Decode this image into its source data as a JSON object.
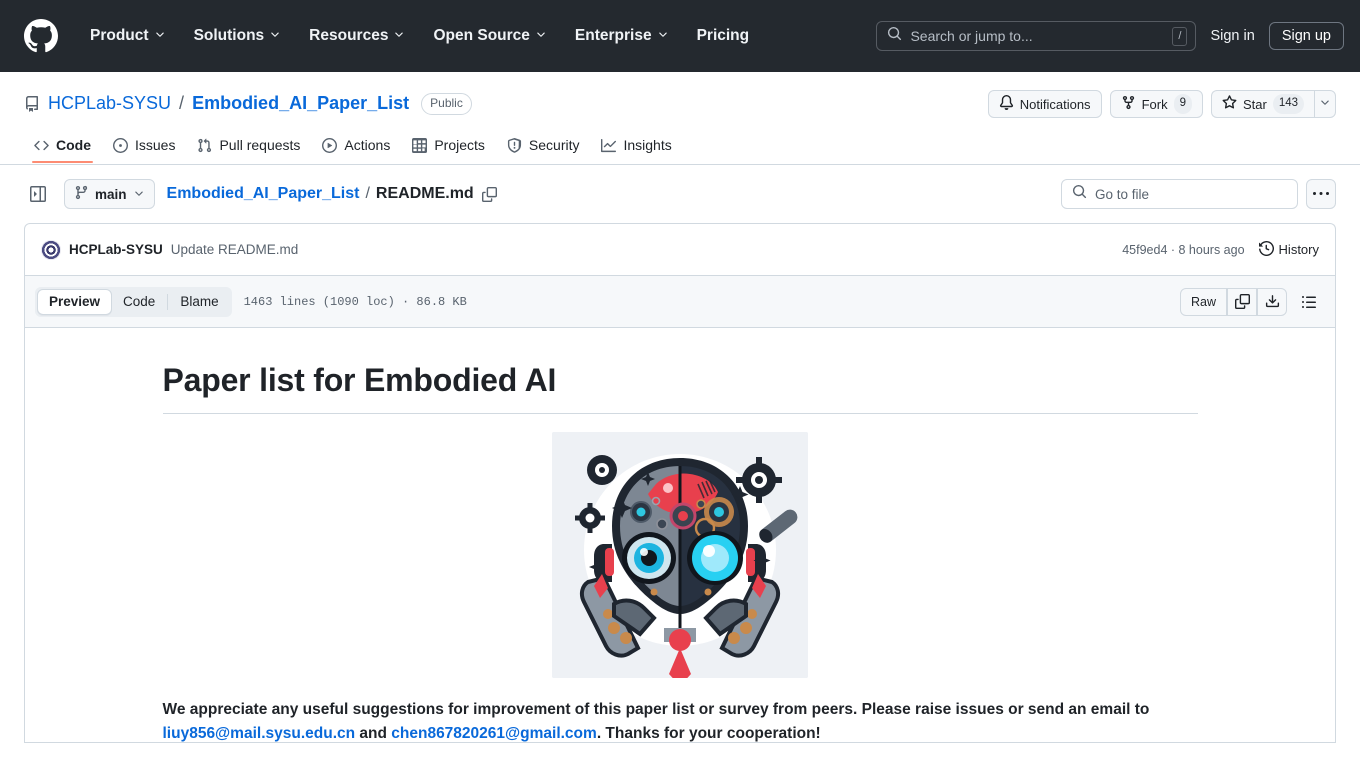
{
  "header": {
    "logo_icon": "github-mark-icon",
    "nav": [
      {
        "label": "Product",
        "has_caret": true
      },
      {
        "label": "Solutions",
        "has_caret": true
      },
      {
        "label": "Resources",
        "has_caret": true
      },
      {
        "label": "Open Source",
        "has_caret": true
      },
      {
        "label": "Enterprise",
        "has_caret": true
      },
      {
        "label": "Pricing",
        "has_caret": false
      }
    ],
    "search": {
      "placeholder": "Search or jump to...",
      "shortcut_key": "/",
      "icon": "search-icon"
    },
    "sign_in": "Sign in",
    "sign_up": "Sign up"
  },
  "repo": {
    "icon": "repo-book-icon",
    "owner": "HCPLab-SYSU",
    "separator": "/",
    "name": "Embodied_AI_Paper_List",
    "visibility": "Public",
    "actions": {
      "notifications": {
        "label": "Notifications",
        "icon": "bell-icon"
      },
      "fork": {
        "label": "Fork",
        "count": "9",
        "icon": "fork-icon"
      },
      "star": {
        "label": "Star",
        "count": "143",
        "icon": "star-icon",
        "caret_icon": "chevron-down-icon"
      }
    },
    "tabs": [
      {
        "label": "Code",
        "icon": "code-icon",
        "active": true
      },
      {
        "label": "Issues",
        "icon": "issue-opened-icon",
        "active": false
      },
      {
        "label": "Pull requests",
        "icon": "git-pull-request-icon",
        "active": false
      },
      {
        "label": "Actions",
        "icon": "play-icon",
        "active": false
      },
      {
        "label": "Projects",
        "icon": "table-icon",
        "active": false
      },
      {
        "label": "Security",
        "icon": "shield-icon",
        "active": false
      },
      {
        "label": "Insights",
        "icon": "graph-icon",
        "active": false
      }
    ]
  },
  "file_nav": {
    "sidebar_toggle_icon": "sidebar-expand-icon",
    "branch": {
      "label": "main",
      "icon": "git-branch-icon",
      "caret_icon": "chevron-down-icon"
    },
    "breadcrumb": {
      "repo": "Embodied_AI_Paper_List",
      "separator": "/",
      "file": "README.md",
      "copy_icon": "copy-path-icon"
    },
    "go_to_file": {
      "placeholder": "Go to file",
      "icon": "search-icon"
    },
    "more_menu": {
      "label": "...",
      "icon": "kebab-horizontal-icon"
    }
  },
  "commit": {
    "avatar": "owner-avatar",
    "author": "HCPLab-SYSU",
    "message": "Update README.md",
    "meta": "45f9ed4 · 8 hours ago",
    "history": {
      "label": "History",
      "icon": "history-icon"
    }
  },
  "file_toolbar": {
    "views": [
      {
        "label": "Preview",
        "active": true
      },
      {
        "label": "Code",
        "active": false
      },
      {
        "label": "Blame",
        "active": false
      }
    ],
    "stats": "1463 lines (1090 loc) · 86.8 KB",
    "raw_label": "Raw",
    "copy_icon": "copy-icon",
    "download_icon": "download-icon",
    "outline_icon": "list-unordered-icon"
  },
  "readme": {
    "heading": "Paper list for Embodied AI",
    "image_alt": "embodied-ai-robot-logo",
    "paragraph": {
      "text_1": "We appreciate any useful suggestions for improvement of this paper list or survey from peers. Please raise issues or send an email to ",
      "email_1": "liuy856@mail.sysu.edu.cn",
      "text_2": " and ",
      "email_2": "chen867820261@gmail.com",
      "text_3": ". Thanks for your cooperation!"
    }
  },
  "colors": {
    "header_bg": "#24292f",
    "link": "#0969da",
    "active_tab_underline": "#fd8c73",
    "border": "#d1d9e0",
    "muted_text": "#59636e",
    "surface": "#f6f8fa"
  }
}
